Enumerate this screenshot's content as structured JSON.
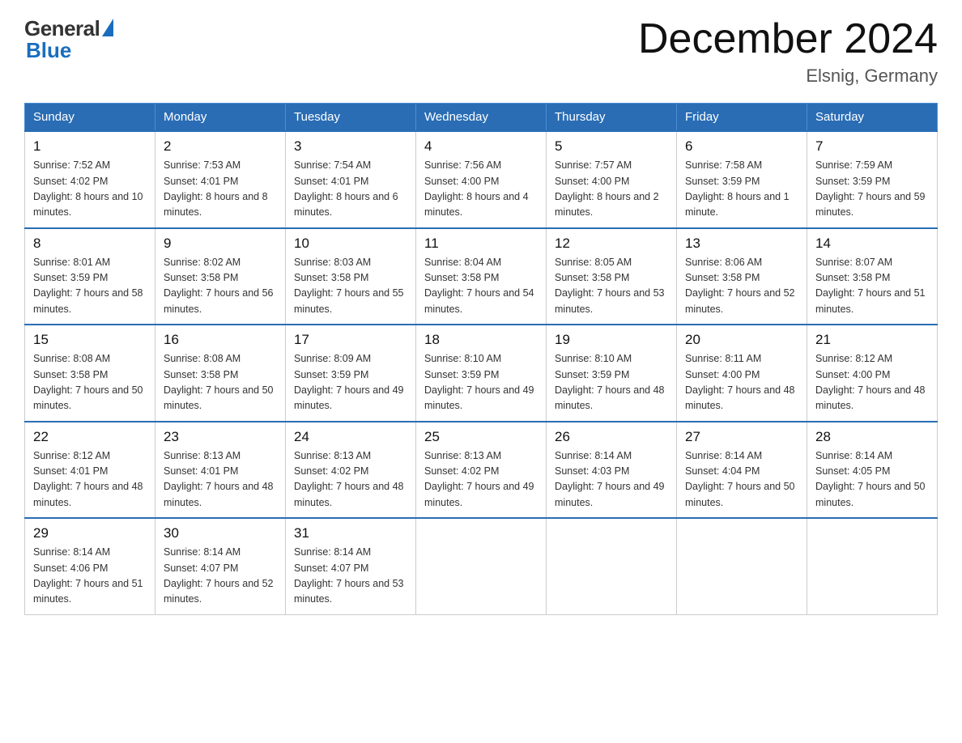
{
  "logo": {
    "general": "General",
    "blue": "Blue"
  },
  "header": {
    "title": "December 2024",
    "location": "Elsnig, Germany"
  },
  "weekdays": [
    "Sunday",
    "Monday",
    "Tuesday",
    "Wednesday",
    "Thursday",
    "Friday",
    "Saturday"
  ],
  "weeks": [
    [
      {
        "day": "1",
        "sunrise": "7:52 AM",
        "sunset": "4:02 PM",
        "daylight": "8 hours and 10 minutes."
      },
      {
        "day": "2",
        "sunrise": "7:53 AM",
        "sunset": "4:01 PM",
        "daylight": "8 hours and 8 minutes."
      },
      {
        "day": "3",
        "sunrise": "7:54 AM",
        "sunset": "4:01 PM",
        "daylight": "8 hours and 6 minutes."
      },
      {
        "day": "4",
        "sunrise": "7:56 AM",
        "sunset": "4:00 PM",
        "daylight": "8 hours and 4 minutes."
      },
      {
        "day": "5",
        "sunrise": "7:57 AM",
        "sunset": "4:00 PM",
        "daylight": "8 hours and 2 minutes."
      },
      {
        "day": "6",
        "sunrise": "7:58 AM",
        "sunset": "3:59 PM",
        "daylight": "8 hours and 1 minute."
      },
      {
        "day": "7",
        "sunrise": "7:59 AM",
        "sunset": "3:59 PM",
        "daylight": "7 hours and 59 minutes."
      }
    ],
    [
      {
        "day": "8",
        "sunrise": "8:01 AM",
        "sunset": "3:59 PM",
        "daylight": "7 hours and 58 minutes."
      },
      {
        "day": "9",
        "sunrise": "8:02 AM",
        "sunset": "3:58 PM",
        "daylight": "7 hours and 56 minutes."
      },
      {
        "day": "10",
        "sunrise": "8:03 AM",
        "sunset": "3:58 PM",
        "daylight": "7 hours and 55 minutes."
      },
      {
        "day": "11",
        "sunrise": "8:04 AM",
        "sunset": "3:58 PM",
        "daylight": "7 hours and 54 minutes."
      },
      {
        "day": "12",
        "sunrise": "8:05 AM",
        "sunset": "3:58 PM",
        "daylight": "7 hours and 53 minutes."
      },
      {
        "day": "13",
        "sunrise": "8:06 AM",
        "sunset": "3:58 PM",
        "daylight": "7 hours and 52 minutes."
      },
      {
        "day": "14",
        "sunrise": "8:07 AM",
        "sunset": "3:58 PM",
        "daylight": "7 hours and 51 minutes."
      }
    ],
    [
      {
        "day": "15",
        "sunrise": "8:08 AM",
        "sunset": "3:58 PM",
        "daylight": "7 hours and 50 minutes."
      },
      {
        "day": "16",
        "sunrise": "8:08 AM",
        "sunset": "3:58 PM",
        "daylight": "7 hours and 50 minutes."
      },
      {
        "day": "17",
        "sunrise": "8:09 AM",
        "sunset": "3:59 PM",
        "daylight": "7 hours and 49 minutes."
      },
      {
        "day": "18",
        "sunrise": "8:10 AM",
        "sunset": "3:59 PM",
        "daylight": "7 hours and 49 minutes."
      },
      {
        "day": "19",
        "sunrise": "8:10 AM",
        "sunset": "3:59 PM",
        "daylight": "7 hours and 48 minutes."
      },
      {
        "day": "20",
        "sunrise": "8:11 AM",
        "sunset": "4:00 PM",
        "daylight": "7 hours and 48 minutes."
      },
      {
        "day": "21",
        "sunrise": "8:12 AM",
        "sunset": "4:00 PM",
        "daylight": "7 hours and 48 minutes."
      }
    ],
    [
      {
        "day": "22",
        "sunrise": "8:12 AM",
        "sunset": "4:01 PM",
        "daylight": "7 hours and 48 minutes."
      },
      {
        "day": "23",
        "sunrise": "8:13 AM",
        "sunset": "4:01 PM",
        "daylight": "7 hours and 48 minutes."
      },
      {
        "day": "24",
        "sunrise": "8:13 AM",
        "sunset": "4:02 PM",
        "daylight": "7 hours and 48 minutes."
      },
      {
        "day": "25",
        "sunrise": "8:13 AM",
        "sunset": "4:02 PM",
        "daylight": "7 hours and 49 minutes."
      },
      {
        "day": "26",
        "sunrise": "8:14 AM",
        "sunset": "4:03 PM",
        "daylight": "7 hours and 49 minutes."
      },
      {
        "day": "27",
        "sunrise": "8:14 AM",
        "sunset": "4:04 PM",
        "daylight": "7 hours and 50 minutes."
      },
      {
        "day": "28",
        "sunrise": "8:14 AM",
        "sunset": "4:05 PM",
        "daylight": "7 hours and 50 minutes."
      }
    ],
    [
      {
        "day": "29",
        "sunrise": "8:14 AM",
        "sunset": "4:06 PM",
        "daylight": "7 hours and 51 minutes."
      },
      {
        "day": "30",
        "sunrise": "8:14 AM",
        "sunset": "4:07 PM",
        "daylight": "7 hours and 52 minutes."
      },
      {
        "day": "31",
        "sunrise": "8:14 AM",
        "sunset": "4:07 PM",
        "daylight": "7 hours and 53 minutes."
      },
      null,
      null,
      null,
      null
    ]
  ]
}
